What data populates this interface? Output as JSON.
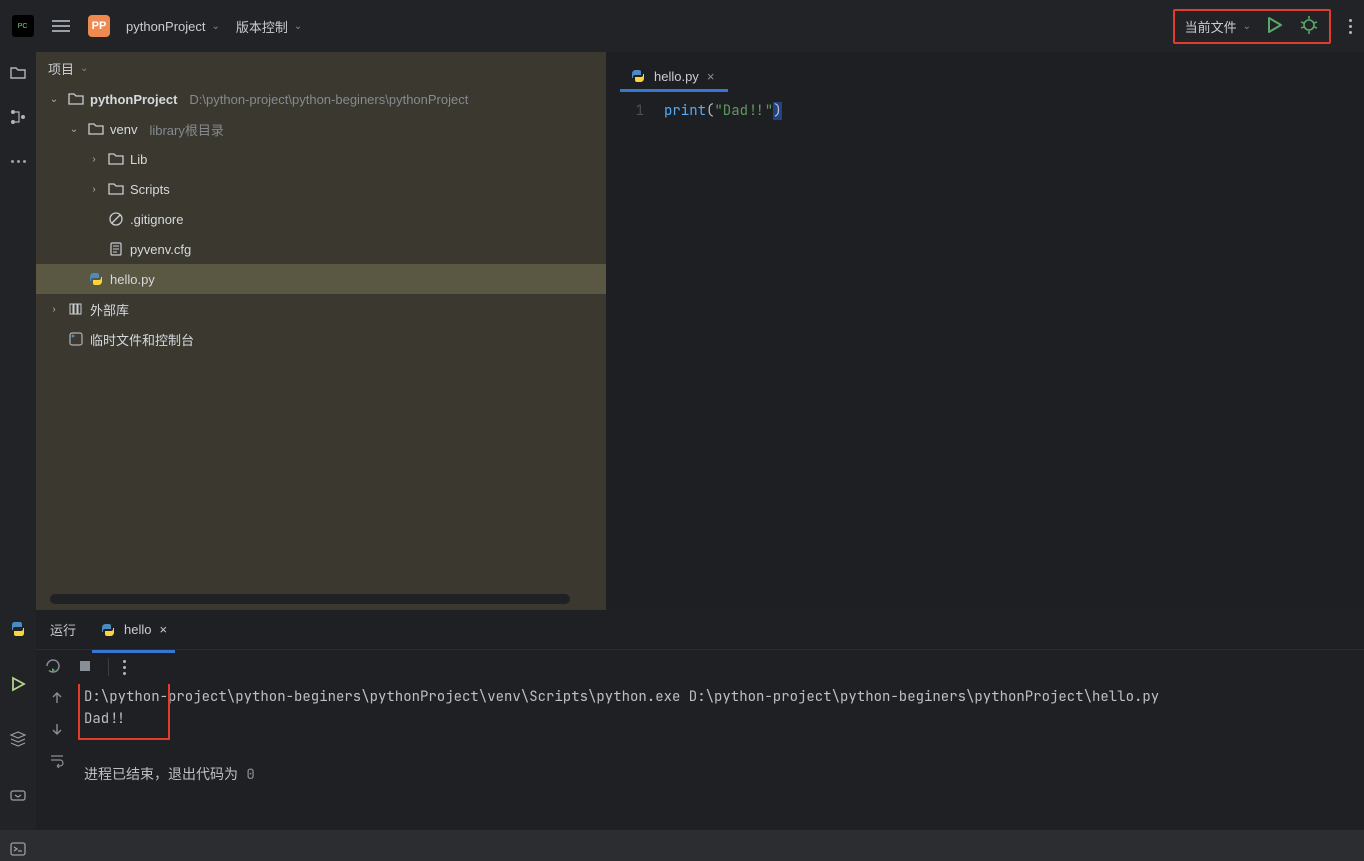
{
  "topbar": {
    "project_name": "pythonProject",
    "vcs_label": "版本控制",
    "run_config": "当前文件"
  },
  "project_panel": {
    "title": "项目",
    "root": {
      "name": "pythonProject",
      "path": "D:\\python-project\\python-beginers\\pythonProject"
    },
    "venv": {
      "name": "venv",
      "hint": "library根目录"
    },
    "lib": "Lib",
    "scripts": "Scripts",
    "gitignore": ".gitignore",
    "pyvenv": "pyvenv.cfg",
    "hello": "hello.py",
    "ext_libs": "外部库",
    "scratch": "临时文件和控制台"
  },
  "editor": {
    "tab_file": "hello.py",
    "line_no": "1",
    "code": {
      "fn": "print",
      "lpar": "(",
      "str": "\"Dad!!\"",
      "rpar": ")"
    }
  },
  "run": {
    "title": "运行",
    "tab": "hello",
    "line1": "D:\\python-project\\python-beginers\\pythonProject\\venv\\Scripts\\python.exe D:\\python-project\\python-beginers\\pythonProject\\hello.py",
    "line2": "Dad!!",
    "exit_pre": "进程已结束，退出代码为 ",
    "exit_code": "0"
  }
}
